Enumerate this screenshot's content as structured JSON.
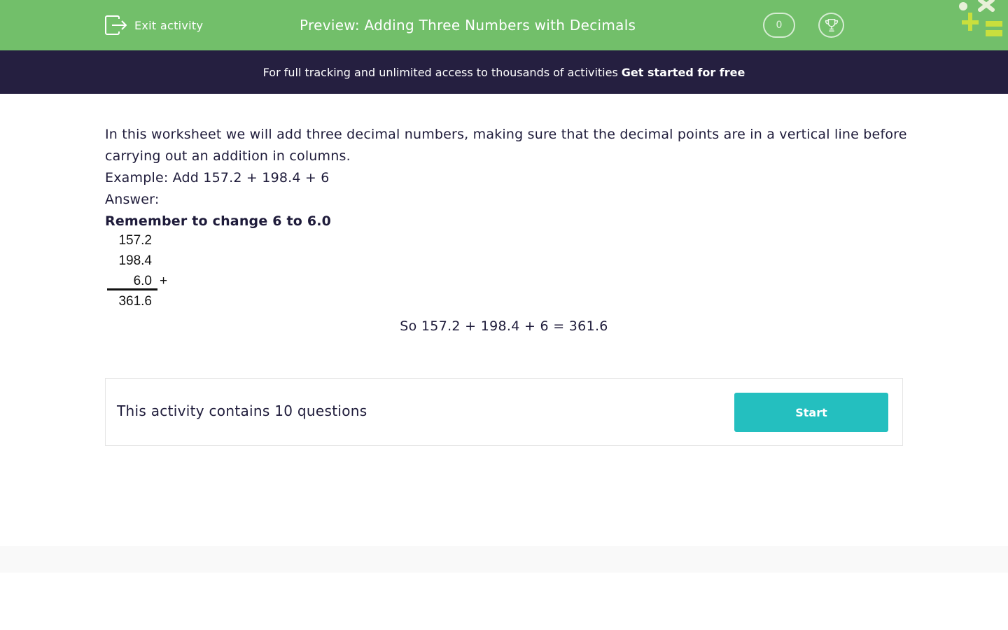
{
  "header": {
    "exit_label": "Exit activity",
    "title": "Preview: Adding Three Numbers with Decimals",
    "score": "0",
    "icons": {
      "exit": "exit-icon",
      "trophy": "trophy-icon",
      "logo": "logo-icon"
    },
    "color": "#72bf6a"
  },
  "banner": {
    "text": "For full tracking and unlimited access to thousands of activities",
    "cta": "Get started for free",
    "color": "#251f40"
  },
  "content": {
    "intro": "In this worksheet we will add three decimal numbers, making sure that the decimal points are in a vertical line before carrying out an addition in columns.",
    "example": "Example: Add 157.2 + 198.4 + 6",
    "answer": "Answer:",
    "reminder": "Remember to change 6 to 6.0",
    "sum": {
      "row1": "157.2",
      "row2": "198.4",
      "row3": "6.0",
      "operator": "+",
      "result": "361.6"
    },
    "conclusion": "So 157.2 + 198.4 + 6 = 361.6"
  },
  "activity": {
    "text": "This activity contains 10 questions",
    "start_label": "Start",
    "button_color": "#24bfbf"
  }
}
